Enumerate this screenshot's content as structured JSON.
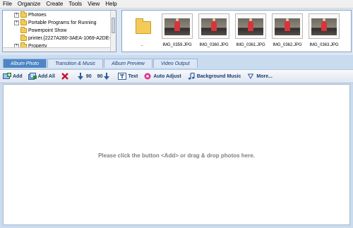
{
  "menu": [
    "File",
    "Organize",
    "Create",
    "Tools",
    "View",
    "Help"
  ],
  "tree": {
    "items": [
      {
        "label": "Photoes",
        "expander": "+"
      },
      {
        "label": "Portable Programs for Running",
        "expander": "+"
      },
      {
        "label": "Powerpoint Show",
        "expander": ""
      },
      {
        "label": "printer.{2227A280-3AEA-1069-A2DE-08",
        "expander": ""
      },
      {
        "label": "Property",
        "expander": "+"
      }
    ]
  },
  "photos": {
    "folder_label": "..",
    "items": [
      "IMG_0359.JPG",
      "IMG_0360.JPG",
      "IMG_0361.JPG",
      "IMG_0362.JPG",
      "IMG_0363.JPG"
    ]
  },
  "tabs": [
    "Album Photo",
    "Transition & Music",
    "Album Preview",
    "Video Output"
  ],
  "toolbar": {
    "add": "Add",
    "add_all": "Add All",
    "rotate_left": "90",
    "rotate_right": "90",
    "text": "Text",
    "auto_adjust": "Auto Adjust",
    "background_music": "Background Music",
    "more": "More..."
  },
  "canvas": {
    "hint": "Please click the button <Add> or drag & drop photos here."
  },
  "colors": {
    "accent": "#4c86c4",
    "panel": "#dbe7f5",
    "delete_red": "#c8102e",
    "auto_adjust_pink": "#e0308f"
  }
}
